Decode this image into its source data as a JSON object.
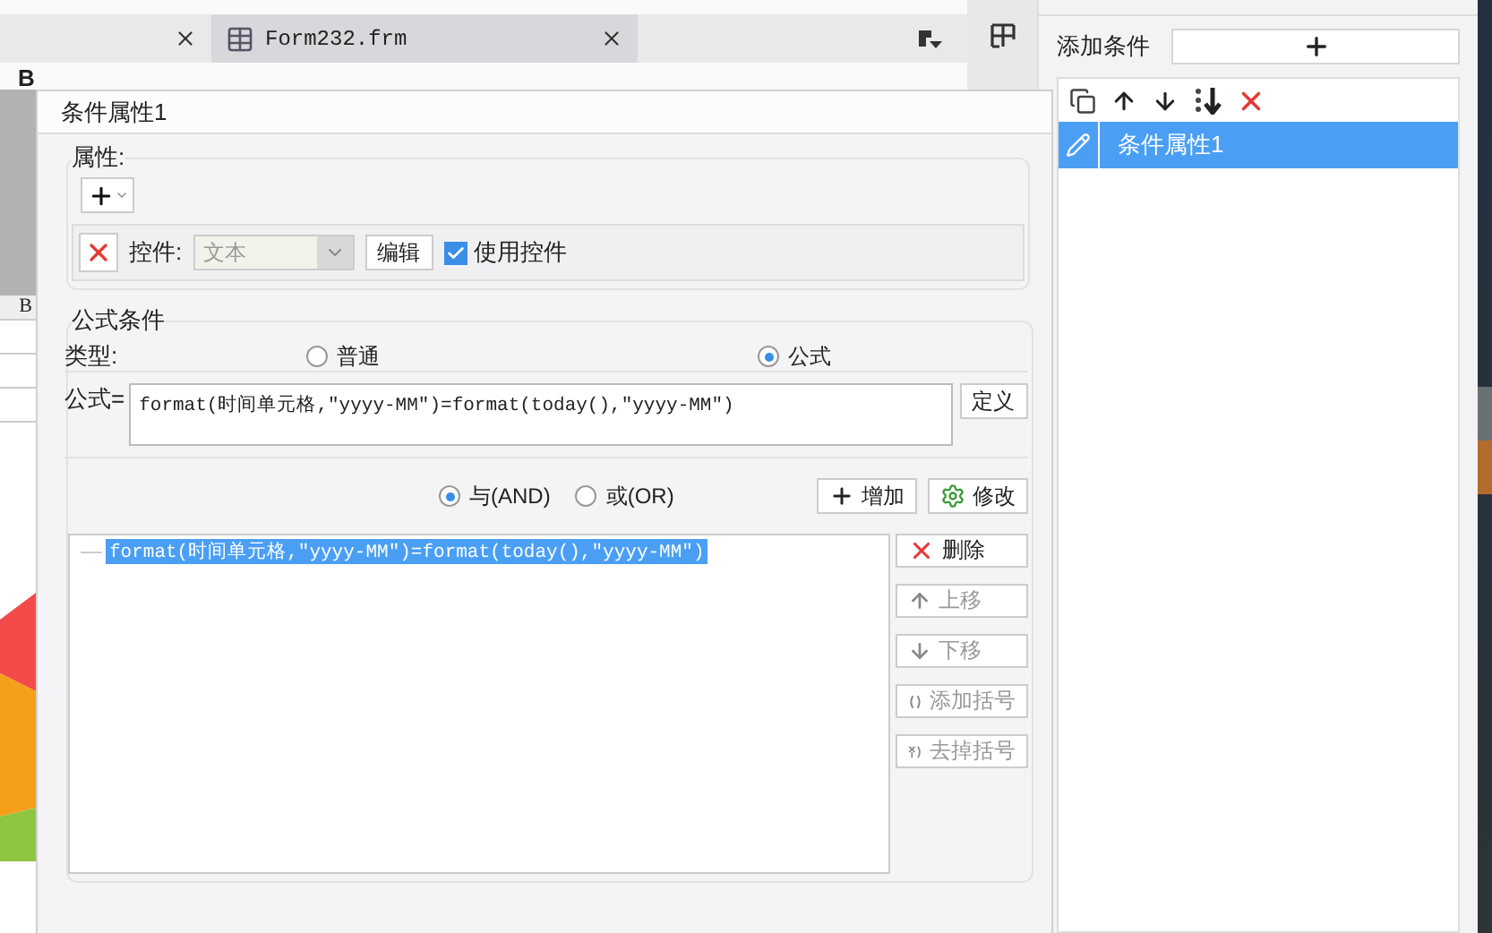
{
  "editor": {
    "tabs": [
      {
        "selected": false
      },
      {
        "label": "Form232.frm",
        "selected": true
      }
    ],
    "toolbar": {
      "bold": "B"
    },
    "sheet": {
      "column_header": "B"
    }
  },
  "dialog": {
    "title": "条件属性1",
    "attributes": {
      "label": "属性:",
      "control_label": "控件:",
      "control_select": {
        "value": "文本",
        "disabled": true
      },
      "edit_button": "编辑",
      "use_control": {
        "label": "使用控件",
        "checked": true
      }
    },
    "formula_condition": {
      "label": "公式条件",
      "type_label": "类型:",
      "types": [
        {
          "label": "普通",
          "selected": false
        },
        {
          "label": "公式",
          "selected": true
        }
      ],
      "formula_label": "公式=",
      "formula": "format(时间单元格,\"yyyy-MM\")=format(today(),\"yyyy-MM\")",
      "define_button": "定义",
      "logic": [
        {
          "label": "与(AND)",
          "selected": true
        },
        {
          "label": "或(OR)",
          "selected": false
        }
      ],
      "add_button": "增加",
      "modify_button": "修改",
      "conditions": [
        {
          "text": "format(时间单元格,\"yyyy-MM\")=format(today(),\"yyyy-MM\")",
          "selected": true
        }
      ],
      "side_buttons": [
        {
          "kind": "delete",
          "label": "删除",
          "disabled": false
        },
        {
          "kind": "up",
          "label": "上移",
          "disabled": true
        },
        {
          "kind": "down",
          "label": "下移",
          "disabled": true
        },
        {
          "kind": "add_bracket",
          "label": "添加括号",
          "disabled": true
        },
        {
          "kind": "remove_bracket",
          "label": "去掉括号",
          "disabled": true
        }
      ]
    }
  },
  "right_panel": {
    "add_label": "添加条件",
    "items": [
      {
        "label": "条件属性1",
        "selected": true
      }
    ]
  }
}
